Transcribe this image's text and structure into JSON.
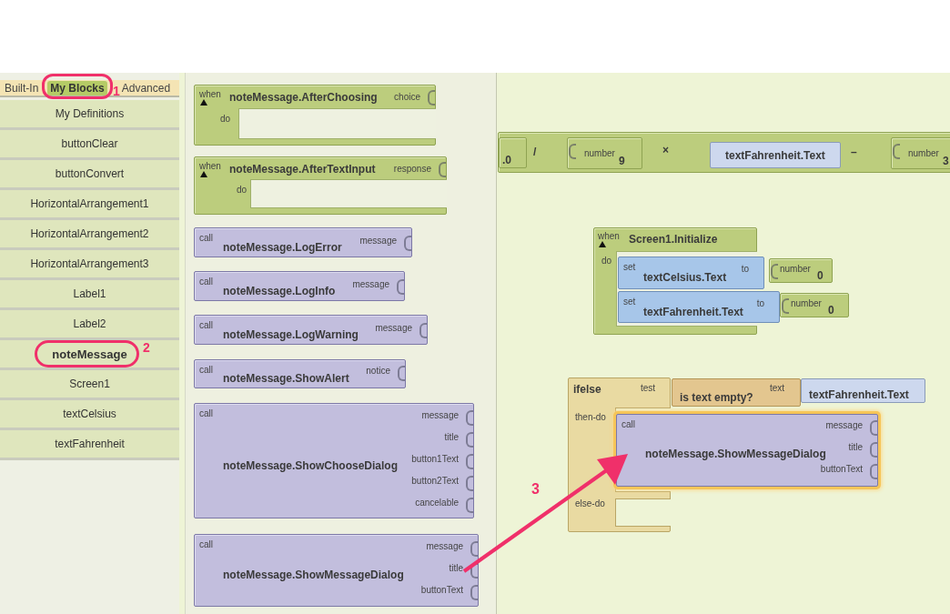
{
  "palette": {
    "tabs": [
      {
        "label": "Built-In",
        "selected": false,
        "circled": false
      },
      {
        "label": "My Blocks",
        "selected": true,
        "circled": true
      },
      {
        "label": "Advanced",
        "selected": false,
        "circled": false
      }
    ],
    "items": [
      {
        "label": "My Definitions",
        "selected": false,
        "circled": false
      },
      {
        "label": "buttonClear",
        "selected": false,
        "circled": false
      },
      {
        "label": "buttonConvert",
        "selected": false,
        "circled": false
      },
      {
        "label": "HorizontalArrangement1",
        "selected": false,
        "circled": false
      },
      {
        "label": "HorizontalArrangement2",
        "selected": false,
        "circled": false
      },
      {
        "label": "HorizontalArrangement3",
        "selected": false,
        "circled": false
      },
      {
        "label": "Label1",
        "selected": false,
        "circled": false
      },
      {
        "label": "Label2",
        "selected": false,
        "circled": false
      },
      {
        "label": "noteMessage",
        "selected": true,
        "circled": true
      },
      {
        "label": "Screen1",
        "selected": false,
        "circled": false
      },
      {
        "label": "textCelsius",
        "selected": false,
        "circled": false
      },
      {
        "label": "textFahrenheit",
        "selected": false,
        "circled": false
      }
    ]
  },
  "drawer": {
    "blocks": [
      {
        "kind": "event",
        "prefix": "when",
        "name": "noteMessage.AfterChoosing",
        "sockets": [
          "choice"
        ],
        "body": "do"
      },
      {
        "kind": "event",
        "prefix": "when",
        "name": "noteMessage.AfterTextInput",
        "sockets": [
          "response"
        ],
        "body": "do"
      },
      {
        "kind": "call",
        "prefix": "call",
        "name": "noteMessage.LogError",
        "sockets": [
          "message"
        ]
      },
      {
        "kind": "call",
        "prefix": "call",
        "name": "noteMessage.LogInfo",
        "sockets": [
          "message"
        ]
      },
      {
        "kind": "call",
        "prefix": "call",
        "name": "noteMessage.LogWarning",
        "sockets": [
          "message"
        ]
      },
      {
        "kind": "call",
        "prefix": "call",
        "name": "noteMessage.ShowAlert",
        "sockets": [
          "notice"
        ]
      },
      {
        "kind": "call",
        "prefix": "call",
        "name": "noteMessage.ShowChooseDialog",
        "sockets": [
          "message",
          "title",
          "button1Text",
          "button2Text",
          "cancelable"
        ]
      },
      {
        "kind": "call",
        "prefix": "call",
        "name": "noteMessage.ShowMessageDialog",
        "sockets": [
          "message",
          "title",
          "buttonText"
        ]
      }
    ]
  },
  "workspace": {
    "formula_row": [
      {
        "kind": "value",
        "text": ".0"
      },
      {
        "kind": "operator",
        "text": "/"
      },
      {
        "kind": "number",
        "label": "number",
        "value": "9"
      },
      {
        "kind": "operator",
        "text": "×"
      },
      {
        "kind": "getter",
        "text": "textFahrenheit.Text"
      },
      {
        "kind": "operator",
        "text": "–"
      },
      {
        "kind": "number",
        "label": "number",
        "value": "3"
      }
    ],
    "initialize": {
      "prefix": "when",
      "name": "Screen1.Initialize",
      "body": "do",
      "statements": [
        {
          "prefix": "set",
          "target": "textCelsius.Text",
          "to": "to",
          "value": {
            "label": "number",
            "value": "0"
          }
        },
        {
          "prefix": "set",
          "target": "textFahrenheit.Text",
          "to": "to",
          "value": {
            "label": "number",
            "value": "0"
          }
        }
      ]
    },
    "ifelse": {
      "name": "ifelse",
      "test": "test",
      "condition": {
        "name": "is text empty?",
        "param": "text",
        "arg": "textFahrenheit.Text"
      },
      "then": "then-do",
      "else": "else-do",
      "then_block": {
        "prefix": "call",
        "name": "noteMessage.ShowMessageDialog",
        "sockets": [
          "message",
          "title",
          "buttonText"
        ],
        "selected": true
      }
    }
  },
  "annotations": [
    {
      "number": "1"
    },
    {
      "number": "2"
    },
    {
      "number": "3"
    }
  ]
}
